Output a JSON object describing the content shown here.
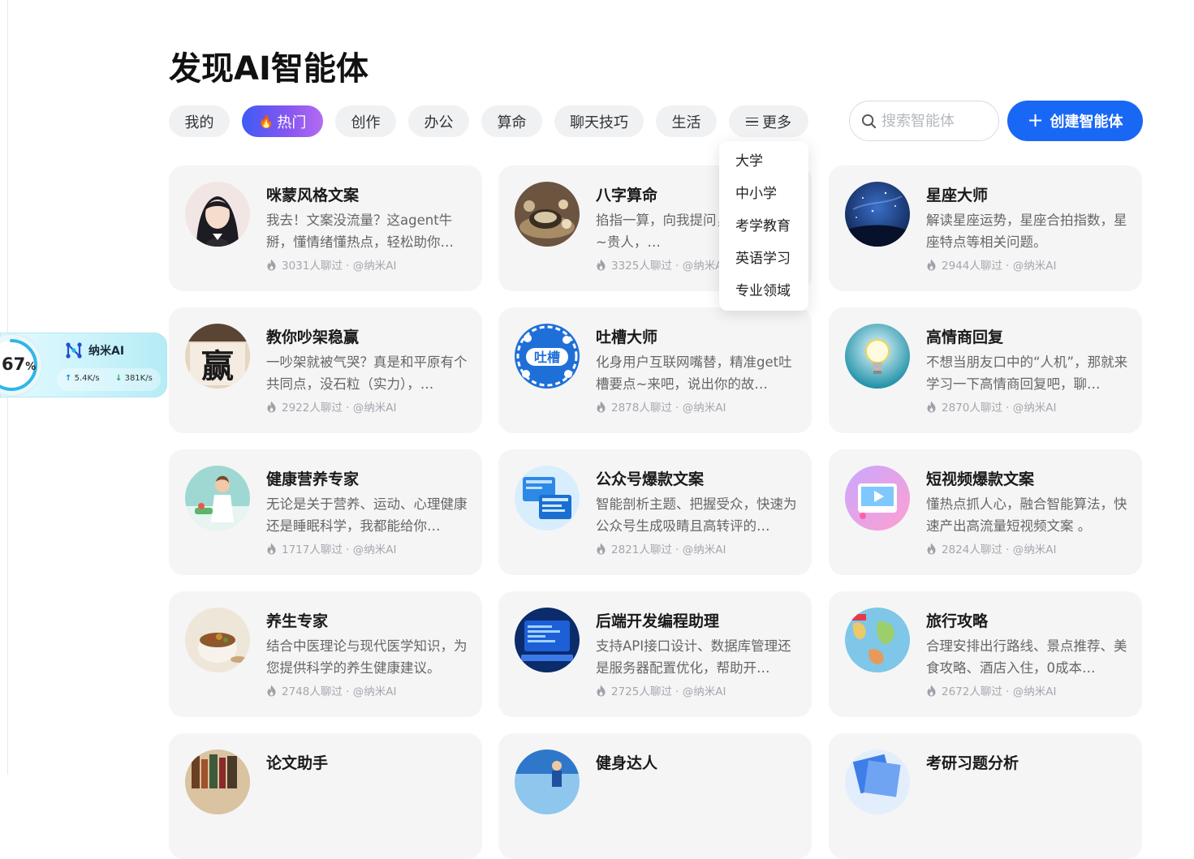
{
  "page": {
    "title": "发现AI智能体"
  },
  "tabs": [
    {
      "label": "我的",
      "active": false
    },
    {
      "label": "热门",
      "active": true,
      "icon": "fire-icon"
    },
    {
      "label": "创作",
      "active": false
    },
    {
      "label": "办公",
      "active": false
    },
    {
      "label": "算命",
      "active": false
    },
    {
      "label": "聊天技巧",
      "active": false
    },
    {
      "label": "生活",
      "active": false
    },
    {
      "label": "更多",
      "active": false,
      "icon": "menu-icon"
    }
  ],
  "search": {
    "placeholder": "搜索智能体"
  },
  "create_button": {
    "label": "创建智能体"
  },
  "more_menu": {
    "items": [
      "大学",
      "中小学",
      "考学教育",
      "英语学习",
      "专业领域"
    ]
  },
  "agents": [
    {
      "title": "咪蒙风格文案",
      "desc": "我去！文案没流量？这agent牛掰，懂情绪懂热点，轻松助你…",
      "meta": "3031人聊过 · @纳米AI",
      "avatar": "portrait-avatar"
    },
    {
      "title": "八字算命",
      "desc": "掐指一算，向我提问，大贵之命啊~贵人，…",
      "meta": "3325人聊过 · @纳米AI",
      "avatar": "fortune-avatar"
    },
    {
      "title": "星座大师",
      "desc": "解读星座运势，星座合拍指数，星座特点等相关问题。",
      "meta": "2944人聊过 · @纳米AI",
      "avatar": "galaxy-avatar"
    },
    {
      "title": "教你吵架稳赢",
      "desc": "一吵架就被气哭？真是和平原有个共同点，没石粒（实力），…",
      "meta": "2922人聊过 · @纳米AI",
      "avatar": "calligraphy-avatar"
    },
    {
      "title": "吐槽大师",
      "desc": "化身用户互联网嘴替，精准get吐槽要点~来吧，说出你的故…",
      "meta": "2878人聊过 · @纳米AI",
      "avatar": "tucao-avatar",
      "avatar_text": "吐槽"
    },
    {
      "title": "高情商回复",
      "desc": "不想当朋友口中的“人机”，那就来学习一下高情商回复吧，聊…",
      "meta": "2870人聊过 · @纳米AI",
      "avatar": "lightbulb-avatar"
    },
    {
      "title": "健康营养专家",
      "desc": "无论是关于营养、运动、心理健康还是睡眠科学，我都能给你…",
      "meta": "1717人聊过 · @纳米AI",
      "avatar": "doctor-avatar"
    },
    {
      "title": "公众号爆款文案",
      "desc": "智能剖析主题、把握受众，快速为公众号生成吸睛且高转评的…",
      "meta": "2821人聊过 · @纳米AI",
      "avatar": "screens-avatar"
    },
    {
      "title": "短视频爆款文案",
      "desc": "懂热点抓人心，融合智能算法，快速产出高流量短视频文案 。",
      "meta": "2824人聊过 · @纳米AI",
      "avatar": "video-avatar"
    },
    {
      "title": "养生专家",
      "desc": "结合中医理论与现代医学知识，为您提供科学的养生健康建议。",
      "meta": "2748人聊过 · @纳米AI",
      "avatar": "herbs-avatar"
    },
    {
      "title": "后端开发编程助理",
      "desc": "支持API接口设计、数据库管理还是服务器配置优化，帮助开…",
      "meta": "2725人聊过 · @纳米AI",
      "avatar": "code-avatar"
    },
    {
      "title": "旅行攻略",
      "desc": "合理安排出行路线、景点推荐、美食攻略、酒店入住，0成本…",
      "meta": "2672人聊过 · @纳米AI",
      "avatar": "map-avatar"
    },
    {
      "title": "论文助手",
      "desc": "",
      "meta": "",
      "avatar": "books-avatar"
    },
    {
      "title": "健身达人",
      "desc": "",
      "meta": "",
      "avatar": "gym-avatar"
    },
    {
      "title": "考研习题分析",
      "desc": "",
      "meta": "",
      "avatar": "papers-avatar"
    }
  ],
  "widget": {
    "percent": "67",
    "percent_unit": "%",
    "percent_value": 0.67,
    "name": "纳米AI",
    "upload": "5.4K/s",
    "download": "381K/s"
  },
  "colors": {
    "accent": "#1967f5",
    "card_bg": "#f5f5f6",
    "tab_bg": "#f0f1f3"
  }
}
